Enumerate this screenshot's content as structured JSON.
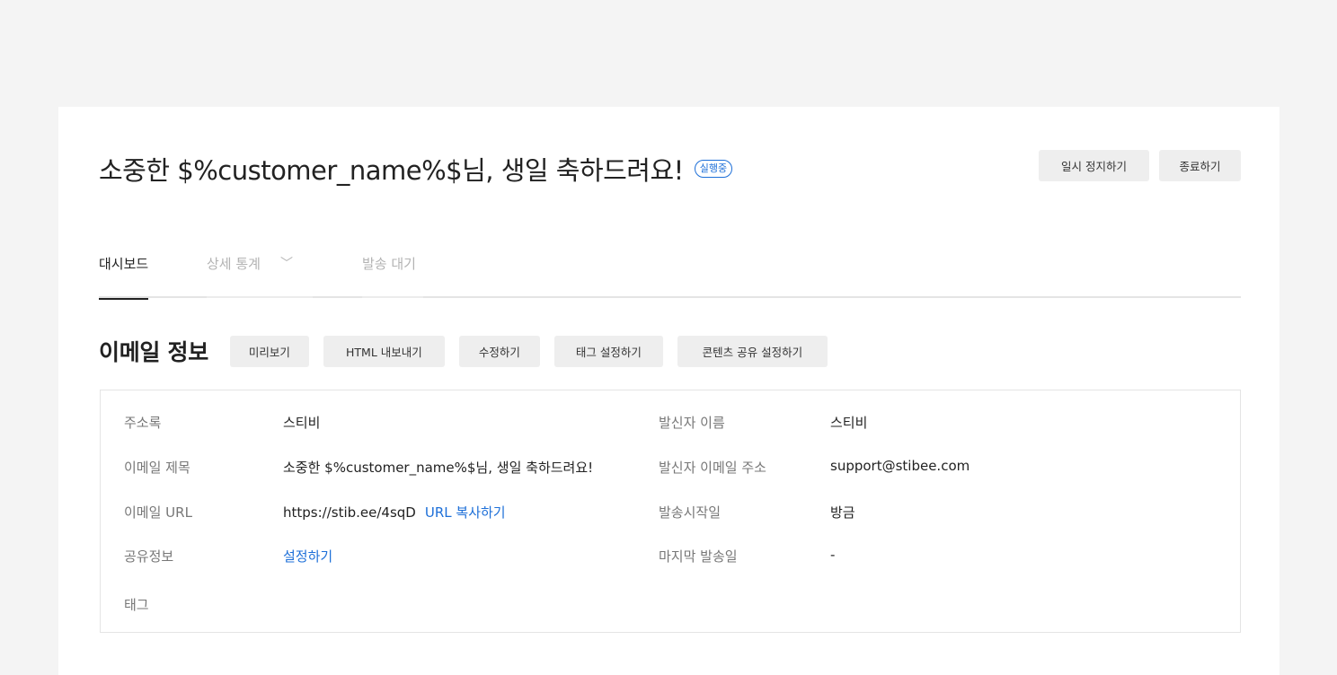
{
  "header": {
    "title": "소중한 $%customer_name%$님, 생일 축하드려요!",
    "status_badge": "실행중",
    "pause_button": "일시 정지하기",
    "end_button": "종료하기"
  },
  "tabs": [
    {
      "label": "대시보드",
      "active": true
    },
    {
      "label": "상세 통계",
      "active": false
    },
    {
      "label": "발송 대기",
      "active": false
    }
  ],
  "section": {
    "title": "이메일 정보",
    "buttons": [
      "미리보기",
      "HTML 내보내기",
      "수정하기",
      "태그 설정하기",
      "콘텐츠 공유 설정하기"
    ]
  },
  "info": {
    "address_book_label": "주소록",
    "address_book_value": "스티비",
    "subject_label": "이메일 제목",
    "subject_value": "소중한 $%customer_name%$님, 생일 축하드려요!",
    "url_label": "이메일 URL",
    "url_value": "https://stib.ee/4sqD",
    "url_copy_link": "URL 복사하기",
    "share_label": "공유정보",
    "share_link": "설정하기",
    "tag_label": "태그",
    "sender_name_label": "발신자 이름",
    "sender_name_value": "스티비",
    "sender_email_label": "발신자 이메일 주소",
    "sender_email_value": "support@stibee.com",
    "send_start_label": "발송시작일",
    "send_start_value": "방금",
    "last_send_label": "마지막 발송일",
    "last_send_value": "-"
  },
  "colors": {
    "accent": "#1d6fd8",
    "background": "#f4f4f4",
    "button_bg": "#eeeeee"
  }
}
